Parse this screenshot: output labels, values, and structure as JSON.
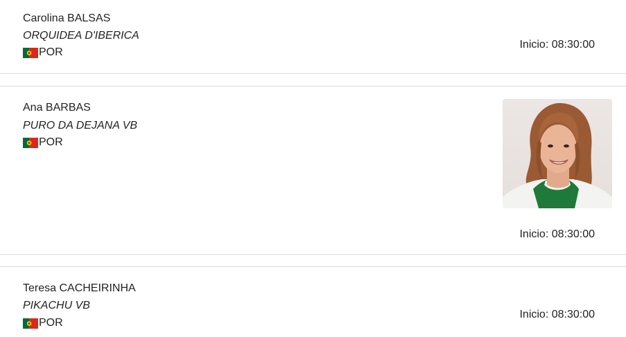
{
  "entries": [
    {
      "rider": "Carolina BALSAS",
      "horse": "ORQUIDEA D'IBERICA",
      "nation": "POR",
      "flag": "portugal-flag-icon",
      "start": "Inicio: 08:30:00",
      "has_photo": false
    },
    {
      "rider": "Ana BARBAS",
      "horse": "PURO DA DEJANA VB",
      "nation": "POR",
      "flag": "portugal-flag-icon",
      "start": "Inicio: 08:30:00",
      "has_photo": true
    },
    {
      "rider": "Teresa CACHEIRINHA",
      "horse": "PIKACHU VB",
      "nation": "POR",
      "flag": "portugal-flag-icon",
      "start": "Inicio: 08:30:00",
      "has_photo": false
    }
  ],
  "colors": {
    "divider": "#d9d9d9",
    "text": "#222222",
    "flag_green": "#046a38",
    "flag_red": "#da291c",
    "flag_yellow": "#ffe900"
  }
}
